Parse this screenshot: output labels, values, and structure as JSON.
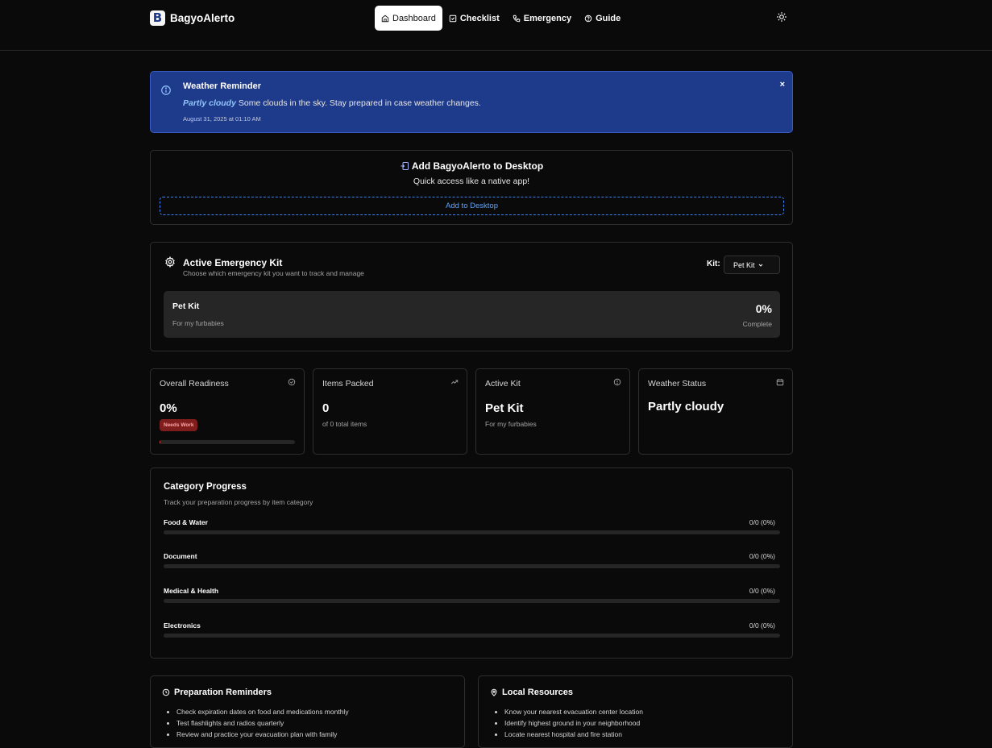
{
  "brand": {
    "name": "BagyoAlerto",
    "logo_letter": "B"
  },
  "nav": [
    {
      "label": "Dashboard",
      "icon": "home-icon",
      "active": true
    },
    {
      "label": "Checklist",
      "icon": "checkbox-icon",
      "active": false
    },
    {
      "label": "Emergency",
      "icon": "phone-icon",
      "active": false
    },
    {
      "label": "Guide",
      "icon": "help-circle-icon",
      "active": false
    }
  ],
  "alert": {
    "title": "Weather Reminder",
    "condition": "Partly cloudy",
    "message": "Some clouds in the sky. Stay prepared in case weather changes.",
    "timestamp": "August 31, 2025 at 01:10 AM",
    "close": "×"
  },
  "install": {
    "title": "Add BagyoAlerto to Desktop",
    "subtitle": "Quick access like a native app!",
    "button": "Add to Desktop"
  },
  "kit": {
    "title": "Active Emergency Kit",
    "subtitle": "Choose which emergency kit you want to track and manage",
    "select_label": "Kit:",
    "selected": "Pet Kit",
    "panel": {
      "name": "Pet Kit",
      "description": "For my furbabies",
      "percent": "0%",
      "percent_label": "Complete"
    }
  },
  "stats": [
    {
      "title": "Overall Readiness",
      "value": "0%",
      "badge": "Needs Work",
      "progress": 0
    },
    {
      "title": "Items Packed",
      "value": "0",
      "sub": "of 0 total items"
    },
    {
      "title": "Active Kit",
      "value": "Pet Kit",
      "sub": "For my furbabies"
    },
    {
      "title": "Weather Status",
      "value": "Partly cloudy"
    }
  ],
  "category_progress": {
    "title": "Category Progress",
    "subtitle": "Track your preparation progress by item category",
    "items": [
      {
        "name": "Food & Water",
        "count": "0/0 (0%)",
        "progress": 0
      },
      {
        "name": "Document",
        "count": "0/0 (0%)",
        "progress": 0
      },
      {
        "name": "Medical & Health",
        "count": "0/0 (0%)",
        "progress": 0
      },
      {
        "name": "Electronics",
        "count": "0/0 (0%)",
        "progress": 0
      }
    ]
  },
  "reminders": {
    "title": "Preparation Reminders",
    "items": [
      "Check expiration dates on food and medications monthly",
      "Test flashlights and radios quarterly",
      "Review and practice your evacuation plan with family"
    ]
  },
  "resources": {
    "title": "Local Resources",
    "items": [
      "Know your nearest evacuation center location",
      "Identify highest ground in your neighborhood",
      "Locate nearest hospital and fire station"
    ]
  },
  "colors": {
    "background": "#0a0a0a",
    "alert": "#1e3a8a",
    "accent": "#3b82f6",
    "danger": "#7f1d1d"
  }
}
